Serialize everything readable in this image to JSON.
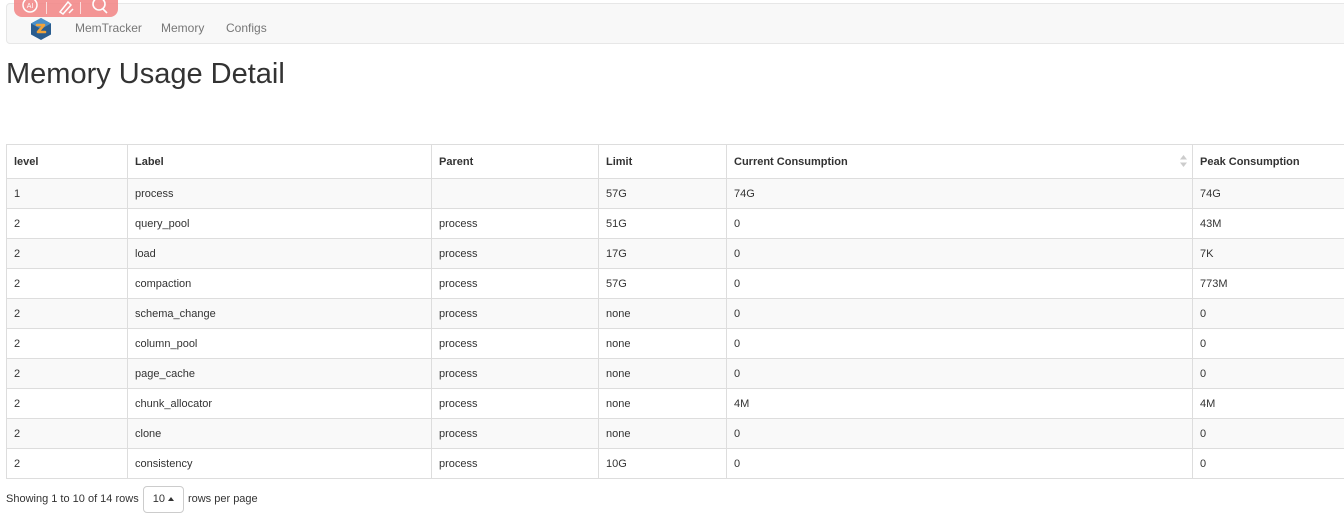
{
  "navbar": {
    "brand": "logo",
    "links": [
      "MemTracker",
      "Memory",
      "Configs"
    ]
  },
  "page": {
    "title": "Memory Usage Detail"
  },
  "table": {
    "columns": [
      "level",
      "Label",
      "Parent",
      "Limit",
      "Current Consumption",
      "Peak Consumption"
    ],
    "rows": [
      [
        "1",
        "process",
        "",
        "57G",
        "74G",
        "74G"
      ],
      [
        "2",
        "query_pool",
        "process",
        "51G",
        "0",
        "43M"
      ],
      [
        "2",
        "load",
        "process",
        "17G",
        "0",
        "7K"
      ],
      [
        "2",
        "compaction",
        "process",
        "57G",
        "0",
        "773M"
      ],
      [
        "2",
        "schema_change",
        "process",
        "none",
        "0",
        "0"
      ],
      [
        "2",
        "column_pool",
        "process",
        "none",
        "0",
        "0"
      ],
      [
        "2",
        "page_cache",
        "process",
        "none",
        "0",
        "0"
      ],
      [
        "2",
        "chunk_allocator",
        "process",
        "none",
        "4M",
        "4M"
      ],
      [
        "2",
        "clone",
        "process",
        "none",
        "0",
        "0"
      ],
      [
        "2",
        "consistency",
        "process",
        "10G",
        "0",
        "0"
      ]
    ]
  },
  "pagination": {
    "showing_text": "Showing 1 to 10 of 14 rows",
    "page_size": "10",
    "suffix": "rows per page"
  },
  "colors": {
    "overlay": "#f38b8b",
    "logo_blue": "#2a5d8f",
    "logo_orange": "#f0a33a"
  }
}
